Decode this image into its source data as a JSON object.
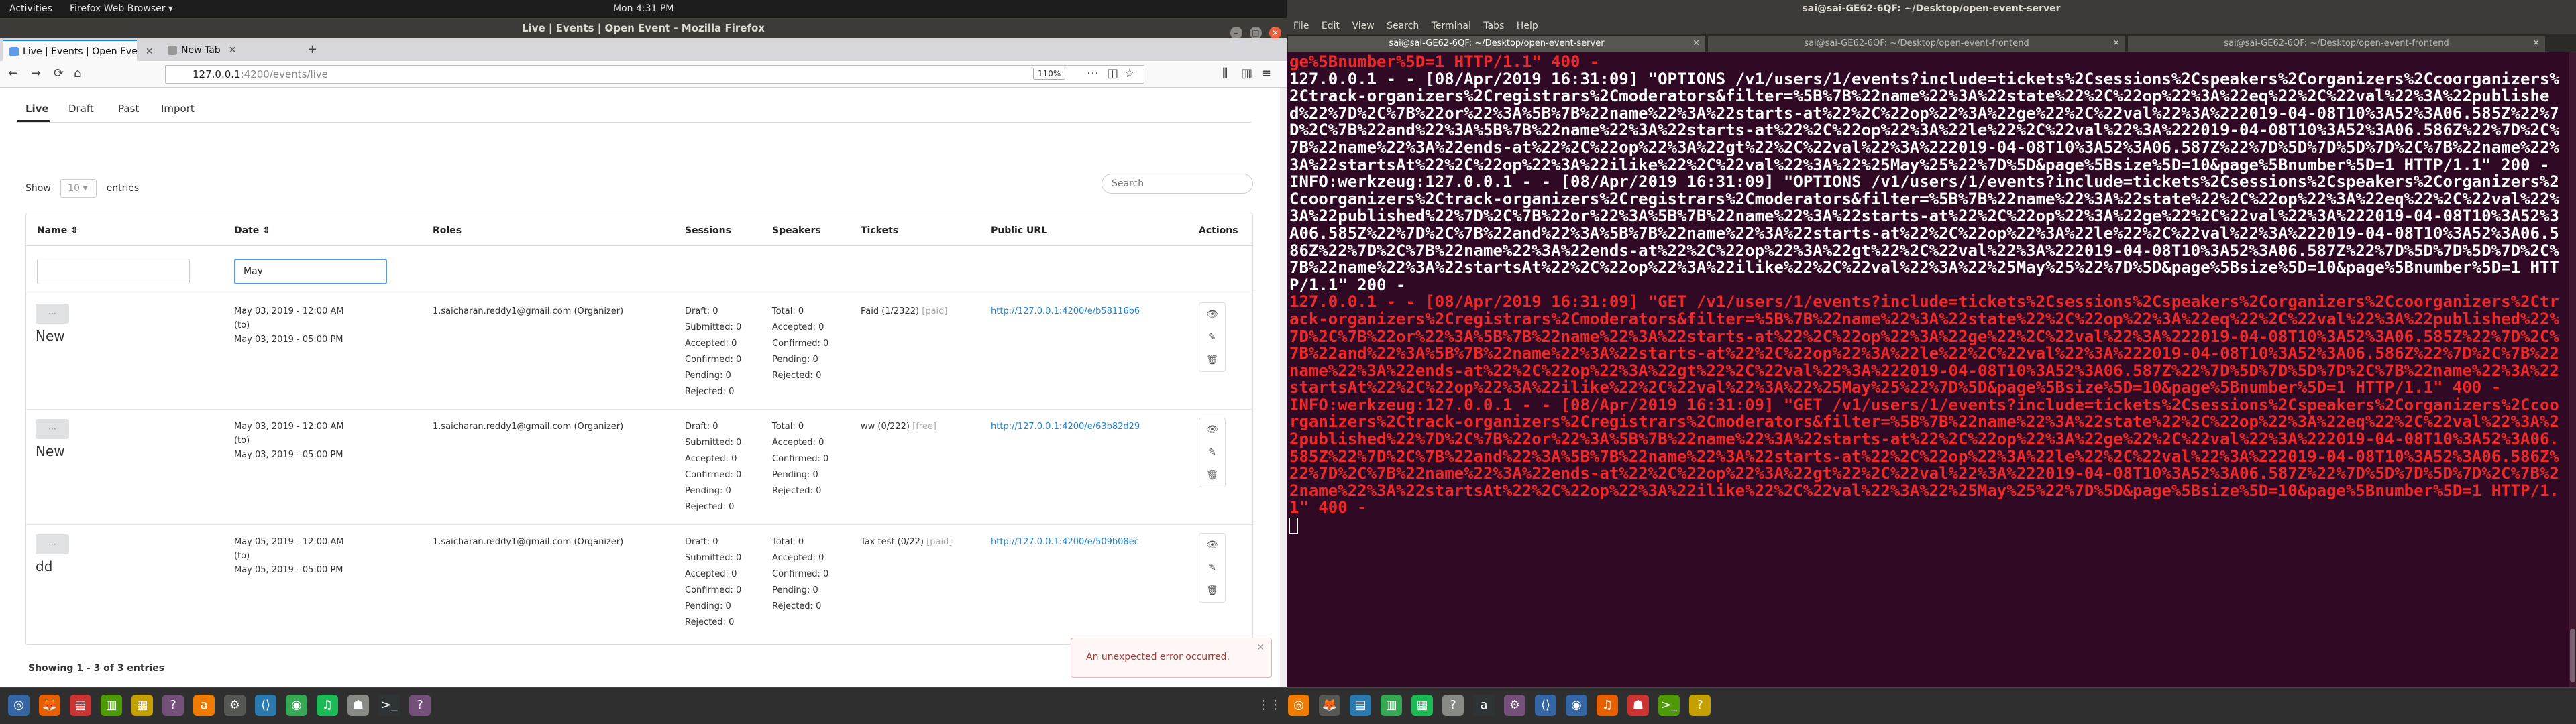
{
  "topbar": {
    "activities": "Activities",
    "app": "Firefox Web Browser ▾",
    "clock": "Mon  4:31 PM",
    "sys": "🖧 🔊 ⏻ ▾"
  },
  "firefox": {
    "window_title": "Live | Events | Open Event - Mozilla Firefox",
    "tabs": [
      {
        "label": "Live | Events | Open Eve"
      },
      {
        "label": "New Tab"
      }
    ],
    "url_host": "127.0.0.1",
    "url_rest": ":4200/events/live",
    "zoom": "110%",
    "nav_back": "←",
    "nav_fwd": "→",
    "nav_reload": "⟳",
    "nav_home": "⌂",
    "new_tab": "+"
  },
  "page": {
    "tabs": [
      "Live",
      "Draft",
      "Past",
      "Import"
    ],
    "show_label": "Show",
    "show_value": "10",
    "entries_label": "entries",
    "search_placeholder": "Search",
    "columns": [
      "Name",
      "Date",
      "Roles",
      "Sessions",
      "Speakers",
      "Tickets",
      "Public URL",
      "Actions"
    ],
    "filter_date_value": "May",
    "rows": [
      {
        "name": "New",
        "date1": "May 03, 2019 - 12:00 AM",
        "date_to": "(to)",
        "date2": "May 03, 2019 - 05:00 PM",
        "role": "1.saicharan.reddy1@gmail.com (Organizer)",
        "sessions": [
          "Draft: 0",
          "Submitted: 0",
          "Accepted: 0",
          "Confirmed: 0",
          "Pending: 0",
          "Rejected: 0"
        ],
        "speakers": [
          "Total: 0",
          "Accepted: 0",
          "Confirmed: 0",
          "Pending: 0",
          "Rejected: 0"
        ],
        "ticket": "Paid (1/2322)",
        "ticket_type": "[paid]",
        "url": "http://127.0.0.1:4200/e/b58116b6"
      },
      {
        "name": "New",
        "date1": "May 03, 2019 - 12:00 AM",
        "date_to": "(to)",
        "date2": "May 03, 2019 - 05:00 PM",
        "role": "1.saicharan.reddy1@gmail.com (Organizer)",
        "sessions": [
          "Draft: 0",
          "Submitted: 0",
          "Accepted: 0",
          "Confirmed: 0",
          "Pending: 0",
          "Rejected: 0"
        ],
        "speakers": [
          "Total: 0",
          "Accepted: 0",
          "Confirmed: 0",
          "Pending: 0",
          "Rejected: 0"
        ],
        "ticket": "ww (0/222)",
        "ticket_type": "[free]",
        "url": "http://127.0.0.1:4200/e/63b82d29"
      },
      {
        "name": "dd",
        "date1": "May 05, 2019 - 12:00 AM",
        "date_to": "(to)",
        "date2": "May 05, 2019 - 05:00 PM",
        "role": "1.saicharan.reddy1@gmail.com (Organizer)",
        "sessions": [
          "Draft: 0",
          "Submitted: 0",
          "Accepted: 0",
          "Confirmed: 0",
          "Pending: 0",
          "Rejected: 0"
        ],
        "speakers": [
          "Total: 0",
          "Accepted: 0",
          "Confirmed: 0",
          "Pending: 0",
          "Rejected: 0"
        ],
        "ticket": "Tax test (0/22)",
        "ticket_type": "[paid]",
        "url": "http://127.0.0.1:4200/e/509b08ec"
      }
    ],
    "showing": "Showing 1 - 3 of 3 entries",
    "toast": "An unexpected error occurred."
  },
  "terminal": {
    "title": "sai@sai-GE62-6QF: ~/Desktop/open-event-server",
    "menu": [
      "File",
      "Edit",
      "View",
      "Search",
      "Terminal",
      "Tabs",
      "Help"
    ],
    "tabs": [
      "sai@sai-GE62-6QF: ~/Desktop/open-event-server",
      "sai@sai-GE62-6QF: ~/Desktop/open-event-frontend",
      "sai@sai-GE62-6QF: ~/Desktop/open-event-frontend"
    ],
    "lines": [
      {
        "t": "ge%5Bnumber%5D=1 HTTP/1.1\" 400 -",
        "err": true
      },
      {
        "t": "127.0.0.1 - - [08/Apr/2019 16:31:09] \"OPTIONS /v1/users/1/events?include=tickets%2Csessions%2Cspeakers%2Corganizers%2Ccoorganizers%2Ctrack-organizers%2Cregistrars%2Cmoderators&filter=%5B%7B%22name%22%3A%22state%22%2C%22op%22%3A%22eq%22%2C%22val%22%3A%22published%22%7D%2C%7B%22or%22%3A%5B%7B%22name%22%3A%22starts-at%22%2C%22op%22%3A%22ge%22%2C%22val%22%3A%222019-04-08T10%3A52%3A06.585Z%22%7D%2C%7B%22and%22%3A%5B%7B%22name%22%3A%22starts-at%22%2C%22op%22%3A%22le%22%2C%22val%22%3A%222019-04-08T10%3A52%3A06.586Z%22%7D%2C%7B%22name%22%3A%22ends-at%22%2C%22op%22%3A%22gt%22%2C%22val%22%3A%222019-04-08T10%3A52%3A06.587Z%22%7D%5D%7D%5D%7D%2C%7B%22name%22%3A%22startsAt%22%2C%22op%22%3A%22ilike%22%2C%22val%22%3A%22%25May%25%22%7D%5D&page%5Bsize%5D=10&page%5Bnumber%5D=1 HTTP/1.1\" 200 -",
        "err": false
      },
      {
        "t": "INFO:werkzeug:127.0.0.1 - - [08/Apr/2019 16:31:09] \"OPTIONS /v1/users/1/events?include=tickets%2Csessions%2Cspeakers%2Corganizers%2Ccoorganizers%2Ctrack-organizers%2Cregistrars%2Cmoderators&filter=%5B%7B%22name%22%3A%22state%22%2C%22op%22%3A%22eq%22%2C%22val%22%3A%22published%22%7D%2C%7B%22or%22%3A%5B%7B%22name%22%3A%22starts-at%22%2C%22op%22%3A%22ge%22%2C%22val%22%3A%222019-04-08T10%3A52%3A06.585Z%22%7D%2C%7B%22and%22%3A%5B%7B%22name%22%3A%22starts-at%22%2C%22op%22%3A%22le%22%2C%22val%22%3A%222019-04-08T10%3A52%3A06.586Z%22%7D%2C%7B%22name%22%3A%22ends-at%22%2C%22op%22%3A%22gt%22%2C%22val%22%3A%222019-04-08T10%3A52%3A06.587Z%22%7D%5D%7D%5D%7D%2C%7B%22name%22%3A%22startsAt%22%2C%22op%22%3A%22ilike%22%2C%22val%22%3A%22%25May%25%22%7D%5D&page%5Bsize%5D=10&page%5Bnumber%5D=1 HTTP/1.1\" 200 -",
        "err": false
      },
      {
        "t": "127.0.0.1 - - [08/Apr/2019 16:31:09] \"GET /v1/users/1/events?include=tickets%2Csessions%2Cspeakers%2Corganizers%2Ccoorganizers%2Ctrack-organizers%2Cregistrars%2Cmoderators&filter=%5B%7B%22name%22%3A%22state%22%2C%22op%22%3A%22eq%22%2C%22val%22%3A%22published%22%7D%2C%7B%22or%22%3A%5B%7B%22name%22%3A%22starts-at%22%2C%22op%22%3A%22ge%22%2C%22val%22%3A%222019-04-08T10%3A52%3A06.585Z%22%7D%2C%7B%22and%22%3A%5B%7B%22name%22%3A%22starts-at%22%2C%22op%22%3A%22le%22%2C%22val%22%3A%222019-04-08T10%3A52%3A06.586Z%22%7D%2C%7B%22name%22%3A%22ends-at%22%2C%22op%22%3A%22gt%22%2C%22val%22%3A%222019-04-08T10%3A52%3A06.587Z%22%7D%5D%7D%5D%7D%2C%7B%22name%22%3A%22startsAt%22%2C%22op%22%3A%22ilike%22%2C%22val%22%3A%22%25May%25%22%7D%5D&page%5Bsize%5D=10&page%5Bnumber%5D=1 HTTP/1.1\" 400 -",
        "err": true
      },
      {
        "t": "INFO:werkzeug:127.0.0.1 - - [08/Apr/2019 16:31:09] \"GET /v1/users/1/events?include=tickets%2Csessions%2Cspeakers%2Corganizers%2Ccoorganizers%2Ctrack-organizers%2Cregistrars%2Cmoderators&filter=%5B%7B%22name%22%3A%22state%22%2C%22op%22%3A%22eq%22%2C%22val%22%3A%22published%22%7D%2C%7B%22or%22%3A%5B%7B%22name%22%3A%22starts-at%22%2C%22op%22%3A%22ge%22%2C%22val%22%3A%222019-04-08T10%3A52%3A06.585Z%22%7D%2C%7B%22and%22%3A%5B%7B%22name%22%3A%22starts-at%22%2C%22op%22%3A%22le%22%2C%22val%22%3A%222019-04-08T10%3A52%3A06.586Z%22%7D%2C%7B%22name%22%3A%22ends-at%22%2C%22op%22%3A%22gt%22%2C%22val%22%3A%222019-04-08T10%3A52%3A06.587Z%22%7D%5D%7D%5D%7D%2C%7B%22name%22%3A%22startsAt%22%2C%22op%22%3A%22ilike%22%2C%22val%22%3A%22%25May%25%22%7D%5D&page%5Bsize%5D=10&page%5Bnumber%5D=1 HTTP/1.1\" 400 -",
        "err": true
      }
    ]
  },
  "taskbar": {
    "left_icons": [
      "app-icon",
      "firefox-icon",
      "slides-icon",
      "notes-icon",
      "files-icon",
      "help-icon",
      "amazon-icon",
      "settings-icon",
      "vscode-icon",
      "chrome-icon",
      "spotify-icon",
      "android-icon",
      "terminal-icon",
      "help-icon"
    ],
    "left_glyphs": [
      "◎",
      "🦊",
      "▤",
      "▥",
      "▦",
      "?",
      "a",
      "⚙",
      "⟨⟩",
      "◉",
      "♫",
      "☗",
      ">_",
      "?"
    ],
    "right_icons": [
      "grid-icon",
      "app-icon",
      "firefox-icon",
      "slides-icon",
      "notes-icon",
      "files-icon",
      "help-icon",
      "amazon-icon",
      "settings-icon",
      "vscode-icon",
      "chrome-icon",
      "spotify-icon",
      "android-icon",
      "terminal-icon",
      "help-icon"
    ],
    "right_glyphs": [
      "⋮⋮",
      "◎",
      "🦊",
      "▤",
      "▥",
      "▦",
      "?",
      "a",
      "⚙",
      "⟨⟩",
      "◉",
      "♫",
      "☗",
      ">_",
      "?"
    ]
  }
}
